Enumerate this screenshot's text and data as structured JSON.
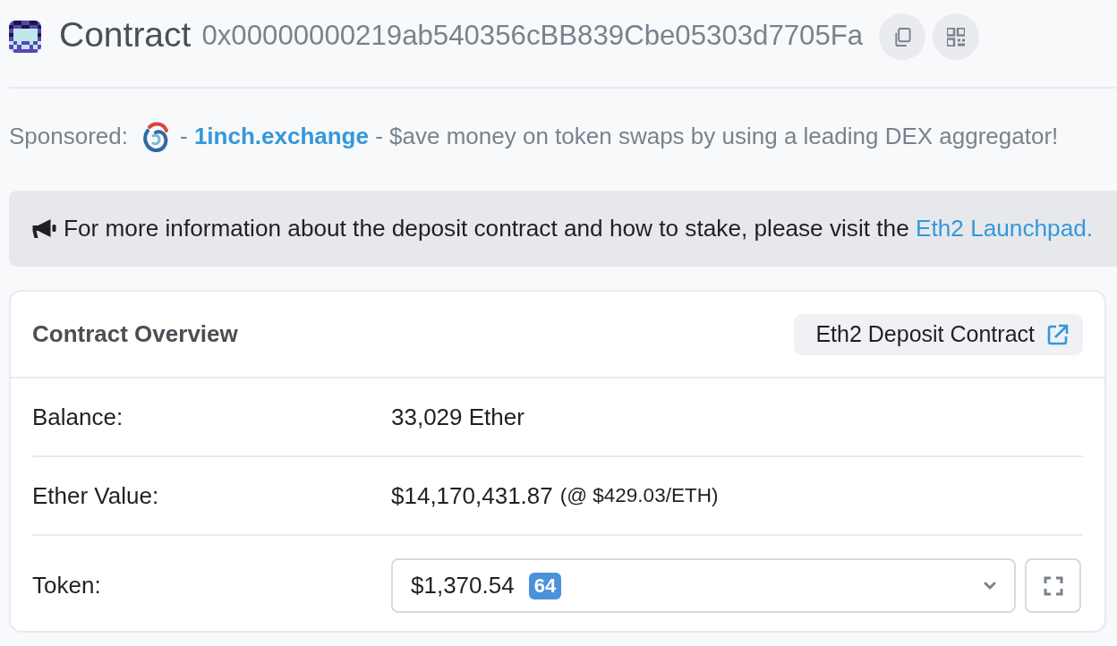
{
  "header": {
    "title": "Contract",
    "address": "0x00000000219ab540356cBB839Cbe05303d7705Fa"
  },
  "sponsored": {
    "label": "Sponsored:",
    "link": "1inch.exchange",
    "prefix": "-",
    "text": "- $ave money on token swaps by using a leading DEX aggregator!"
  },
  "alert": {
    "text": "For more information about the deposit contract and how to stake, please visit the",
    "link": "Eth2 Launchpad."
  },
  "card": {
    "title": "Contract Overview",
    "button": "Eth2 Deposit Contract",
    "rows": [
      {
        "kind": "text",
        "label": "Balance:",
        "value": "33,029 Ether"
      },
      {
        "kind": "text",
        "label": "Ether Value:",
        "value": "$14,170,431.87",
        "note": "(@ $429.03/ETH)"
      },
      {
        "kind": "select",
        "label": "Token:",
        "value": "$1,370.54",
        "badge": "64"
      }
    ]
  }
}
